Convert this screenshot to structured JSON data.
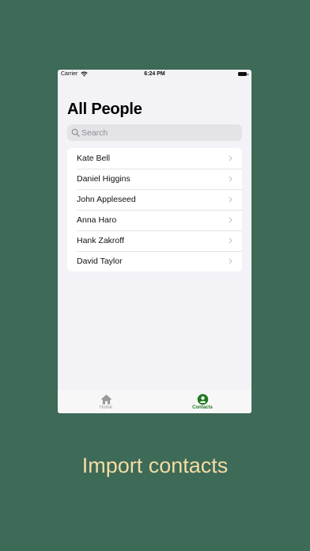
{
  "status_bar": {
    "carrier": "Carrier",
    "time": "6:24 PM"
  },
  "header": {
    "title": "All People"
  },
  "search": {
    "placeholder": "Search",
    "value": ""
  },
  "contacts": [
    {
      "name": "Kate Bell"
    },
    {
      "name": "Daniel Higgins"
    },
    {
      "name": "John Appleseed"
    },
    {
      "name": "Anna Haro"
    },
    {
      "name": "Hank Zakroff"
    },
    {
      "name": "David Taylor"
    }
  ],
  "tab_bar": {
    "tabs": [
      {
        "label": "Home",
        "icon": "home-icon",
        "selected": false
      },
      {
        "label": "Contacts",
        "icon": "person-circle-icon",
        "selected": true
      }
    ]
  },
  "caption": "Import contacts",
  "colors": {
    "background": "#3e6a58",
    "accent": "#1f7a1f",
    "caption": "#f3dca3"
  }
}
